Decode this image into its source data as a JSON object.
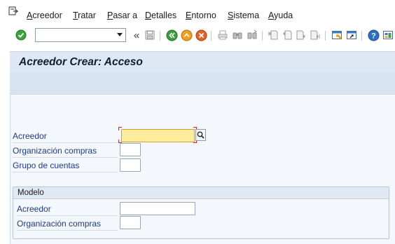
{
  "menu": {
    "items": [
      {
        "label": "Acreedor"
      },
      {
        "label": "Tratar"
      },
      {
        "label": "Pasar a"
      },
      {
        "label": "Detalles"
      },
      {
        "label": "Entorno"
      },
      {
        "label": "Sistema"
      },
      {
        "label": "Ayuda"
      }
    ]
  },
  "toolbar": {
    "command_field_value": "",
    "back_chevrons": "«"
  },
  "title": "Acreedor Crear: Acceso",
  "form": {
    "acreedor_label": "Acreedor",
    "acreedor_value": "",
    "org_compras_label": "Organización compras",
    "org_compras_value": "",
    "grupo_cuentas_label": "Grupo de cuentas",
    "grupo_cuentas_value": ""
  },
  "modelo": {
    "title": "Modelo",
    "acreedor_label": "Acreedor",
    "acreedor_value": "",
    "org_compras_label": "Organización compras",
    "org_compras_value": ""
  },
  "colors": {
    "active_field": "#fcec9c",
    "label_blue": "#1f3a8a",
    "title_bg": "#dde8f4"
  }
}
